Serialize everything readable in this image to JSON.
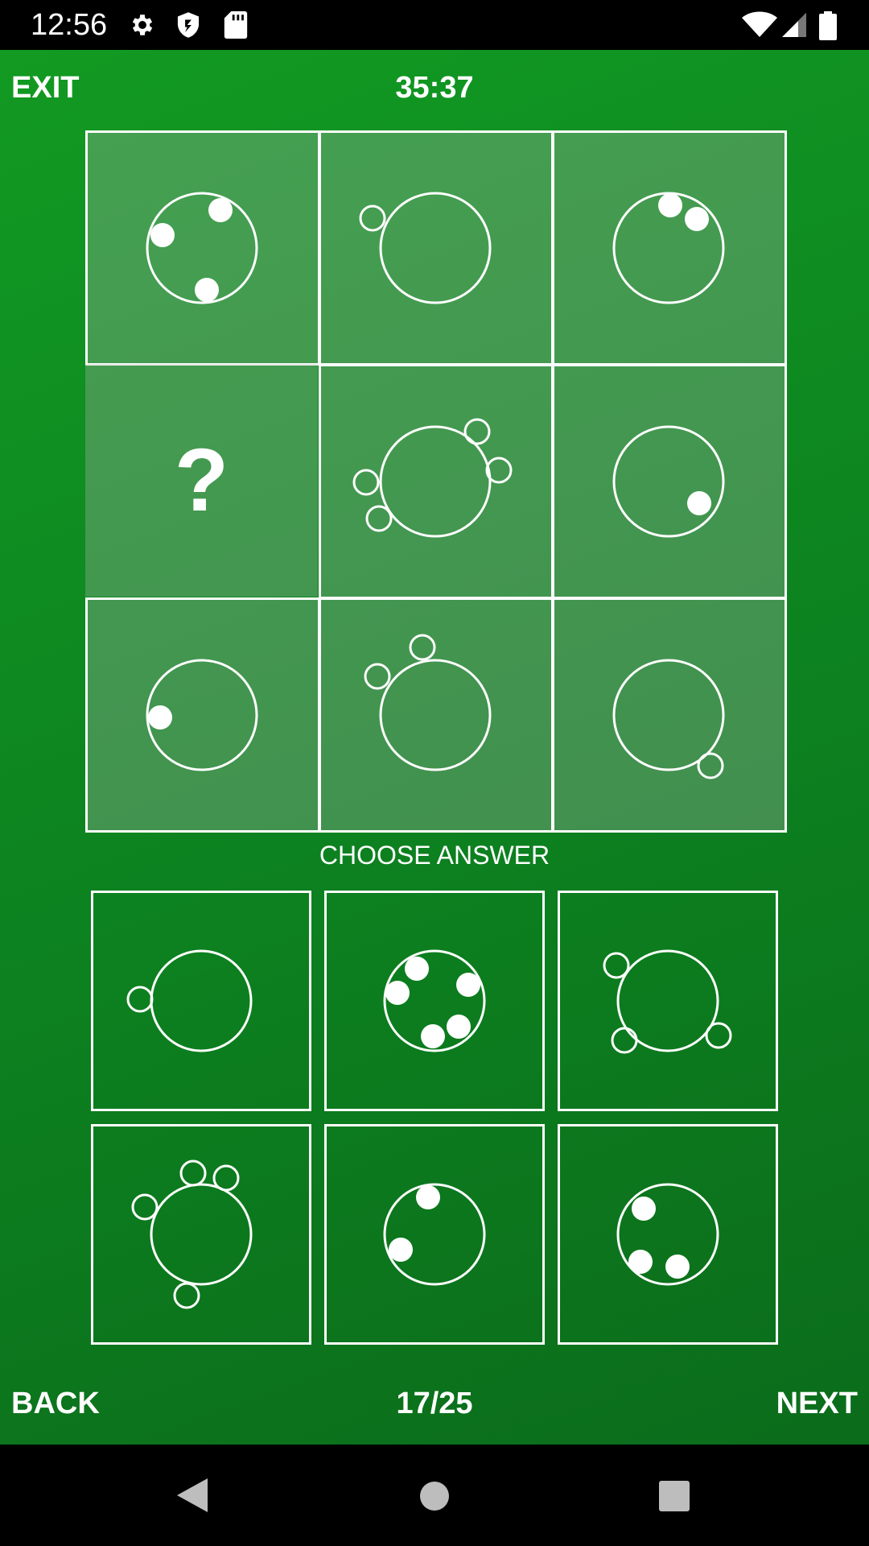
{
  "status_bar": {
    "time": "12:56",
    "icons": [
      "gear-icon",
      "shield-icon",
      "sd-card-icon"
    ],
    "right_icons": [
      "wifi-icon",
      "signal-icon",
      "battery-icon"
    ]
  },
  "header": {
    "exit_label": "EXIT",
    "timer": "35:37"
  },
  "puzzle": {
    "missing_symbol": "?"
  },
  "answers": {
    "label": "CHOOSE ANSWER"
  },
  "footer": {
    "back_label": "BACK",
    "progress": "17/25",
    "next_label": "NEXT"
  },
  "nav": {
    "icons": [
      "back-triangle-icon",
      "home-circle-icon",
      "recents-square-icon"
    ]
  },
  "colors": {
    "background_top": "#129a22",
    "background_bottom": "#0b6c1b",
    "cell_fill": "rgba(180,180,180,0.32)",
    "stroke": "#ffffff"
  }
}
